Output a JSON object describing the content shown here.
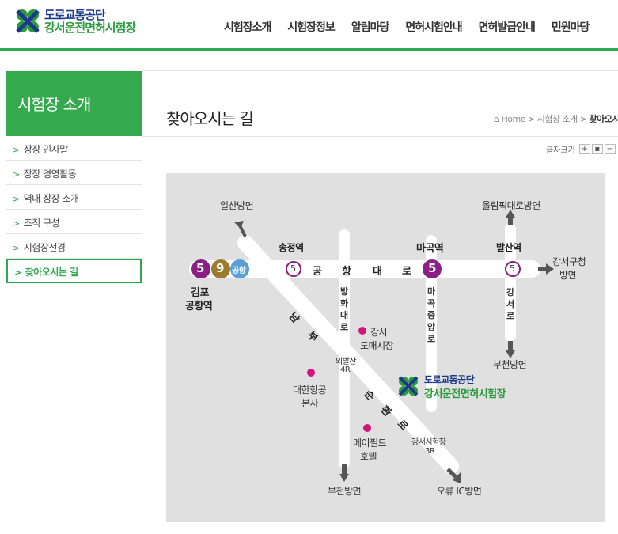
{
  "logo": {
    "org": "도로교통공단",
    "site": "강서운전면허시험장"
  },
  "gnb": [
    "시험장소개",
    "시험장정보",
    "알림마당",
    "면허시험안내",
    "면허발급안내",
    "민원마당"
  ],
  "sidebar": {
    "title": "시험장 소개",
    "items": [
      {
        "label": "장장 인사말"
      },
      {
        "label": "장장 경영활동"
      },
      {
        "label": "역대 장장 소개"
      },
      {
        "label": "조직 구성"
      },
      {
        "label": "시험장전경"
      },
      {
        "label": "찾아오시는 길"
      }
    ]
  },
  "page": {
    "title": "찾아오시는 길",
    "breadcrumb": {
      "home": "Home",
      "sep": ">",
      "parent": "시험장 소개",
      "current": "찾아오시"
    },
    "font_size_label": "글자크기",
    "font_buttons": [
      "+",
      "▪",
      "−"
    ]
  },
  "map": {
    "directions": {
      "ilsan": "일산방면",
      "olympic": "올림픽대로방면",
      "gangseo_gu_1": "강서구청",
      "gangseo_gu_2": "방면",
      "bucheon_right": "부천방면",
      "bucheon_bottom": "부천방면",
      "oryu": "오류 IC방면"
    },
    "stations": {
      "gimpo_1": "김포",
      "gimpo_2": "공항역",
      "songjeong": "송정역",
      "magok": "마곡역",
      "balsan": "발산역"
    },
    "badges": {
      "line5": "5",
      "line9": "9",
      "airport": "공항"
    },
    "road_airport": [
      "공",
      "항",
      "대",
      "로"
    ],
    "road_banghwa": [
      "방",
      "화",
      "대",
      "로"
    ],
    "road_magok": [
      "마",
      "곡",
      "중",
      "앙",
      "로"
    ],
    "road_gangseo": [
      "강",
      "서",
      "로"
    ],
    "road_nambu": [
      "남",
      "부"
    ],
    "road_sunhwan": [
      "순",
      "환",
      "로"
    ],
    "places": {
      "market_1": "강서",
      "market_2": "도매시장",
      "korean_air_1": "대한항공",
      "korean_air_2": "본사",
      "mayfield_1": "메이필드",
      "mayfield_2": "호텔",
      "oebalsan_1": "외발산",
      "oebalsan_2": "4R",
      "testsite_rot_1": "강서시험장",
      "testsite_rot_2": "3R"
    },
    "test_site": {
      "org": "도로교통공단",
      "name": "강서운전면허시험장"
    },
    "colors": {
      "line5": "#8b1f86",
      "line9": "#9c7a2e",
      "airport": "#5aa0d6",
      "place_dot": "#d4147b",
      "road": "#ffffff",
      "bg": "#e0e0e0"
    }
  }
}
